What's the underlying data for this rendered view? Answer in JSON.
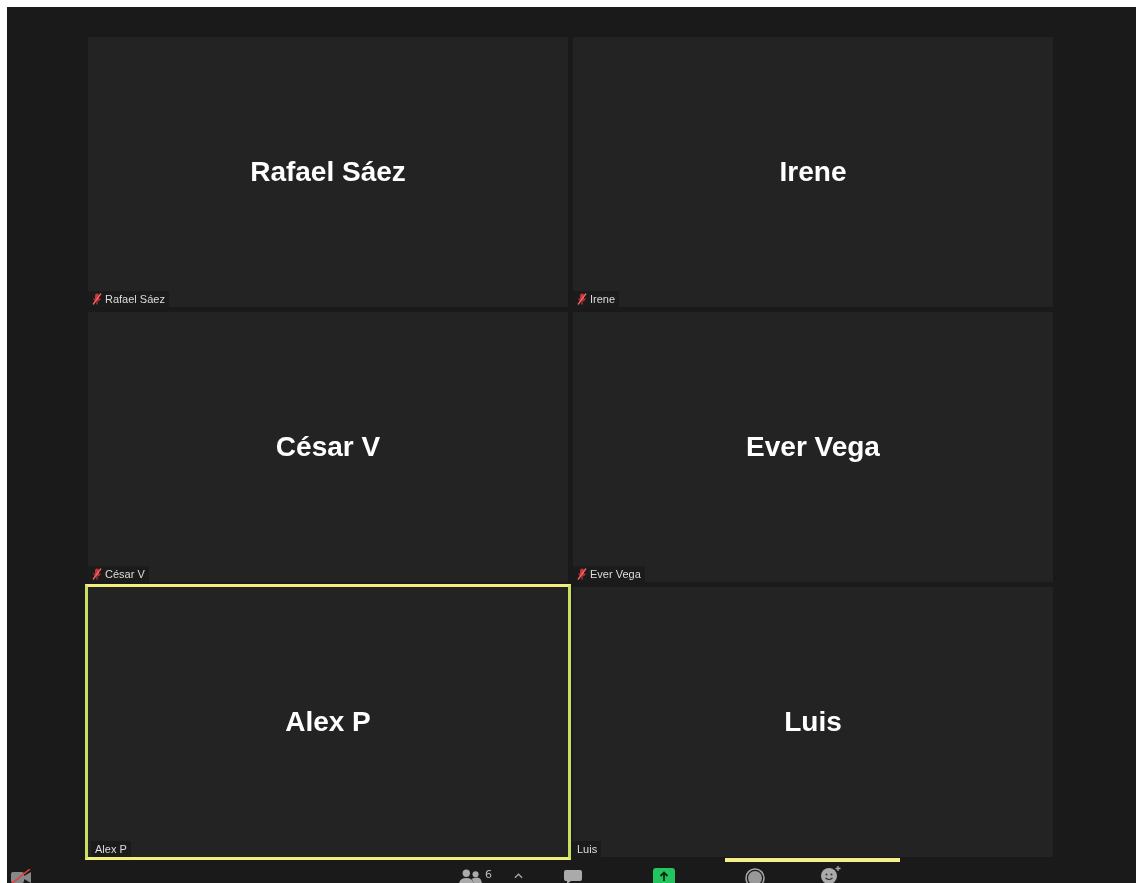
{
  "participants": [
    {
      "name": "Rafael Sáez",
      "label": "Rafael Sáez",
      "muted": true,
      "active_speaker": false
    },
    {
      "name": "Irene",
      "label": "Irene",
      "muted": true,
      "active_speaker": false
    },
    {
      "name": "César V",
      "label": "César V",
      "muted": true,
      "active_speaker": false
    },
    {
      "name": "Ever Vega",
      "label": "Ever Vega",
      "muted": true,
      "active_speaker": false
    },
    {
      "name": "Alex P",
      "label": "Alex P",
      "muted": false,
      "active_speaker": true
    },
    {
      "name": "Luis",
      "label": "Luis",
      "muted": false,
      "active_speaker": false
    }
  ],
  "toolbar": {
    "video_on": false,
    "participant_count": "6"
  }
}
